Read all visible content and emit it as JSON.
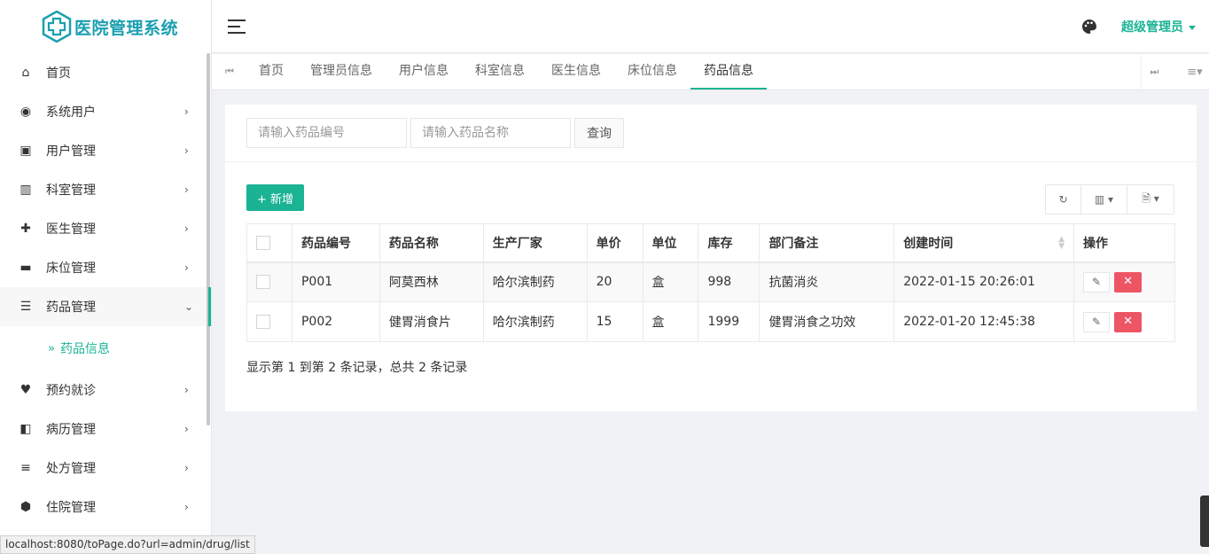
{
  "app": {
    "title": "医院管理系统"
  },
  "sidebar": {
    "items": [
      {
        "label": "首页",
        "icon": "home-icon",
        "arrow": ""
      },
      {
        "label": "系统用户",
        "icon": "user-circle-icon",
        "arrow": "›"
      },
      {
        "label": "用户管理",
        "icon": "id-card-icon",
        "arrow": "›"
      },
      {
        "label": "科室管理",
        "icon": "building-icon",
        "arrow": "›"
      },
      {
        "label": "医生管理",
        "icon": "user-plus-icon",
        "arrow": "›"
      },
      {
        "label": "床位管理",
        "icon": "bed-icon",
        "arrow": "›"
      },
      {
        "label": "药品管理",
        "icon": "list-icon",
        "arrow": "⌄"
      },
      {
        "label": "预约就诊",
        "icon": "heartbeat-icon",
        "arrow": "›"
      },
      {
        "label": "病历管理",
        "icon": "book-icon",
        "arrow": "›"
      },
      {
        "label": "处方管理",
        "icon": "checklist-icon",
        "arrow": "›"
      },
      {
        "label": "住院管理",
        "icon": "shield-icon",
        "arrow": "›"
      }
    ],
    "submenu": {
      "label": "药品信息",
      "chevron": "»"
    }
  },
  "header": {
    "user": "超级管理员"
  },
  "tabs": [
    "首页",
    "管理员信息",
    "用户信息",
    "科室信息",
    "医生信息",
    "床位信息",
    "药品信息"
  ],
  "active_tab": "药品信息",
  "search": {
    "code_placeholder": "请输入药品编号",
    "name_placeholder": "请输入药品名称",
    "button": "查询"
  },
  "toolbar": {
    "add": "+ 新增"
  },
  "table": {
    "columns": [
      "药品编号",
      "药品名称",
      "生产厂家",
      "单价",
      "单位",
      "库存",
      "部门备注",
      "创建时间",
      "操作"
    ],
    "rows": [
      [
        "P001",
        "阿莫西林",
        "哈尔滨制药",
        "20",
        "盒",
        "998",
        "抗菌消炎",
        "2022-01-15 20:26:01"
      ],
      [
        "P002",
        "健胃消食片",
        "哈尔滨制药",
        "15",
        "盒",
        "1999",
        "健胃消食之功效",
        "2022-01-20 12:45:38"
      ]
    ]
  },
  "pagination": {
    "info": "显示第 1 到第 2 条记录，总共 2 条记录"
  },
  "status_bar": {
    "url": "localhost:8080/toPage.do?url=admin/drug/list"
  },
  "colors": {
    "accent": "#1ab394",
    "danger": "#ed5565",
    "logo": "#1a9fb0"
  }
}
